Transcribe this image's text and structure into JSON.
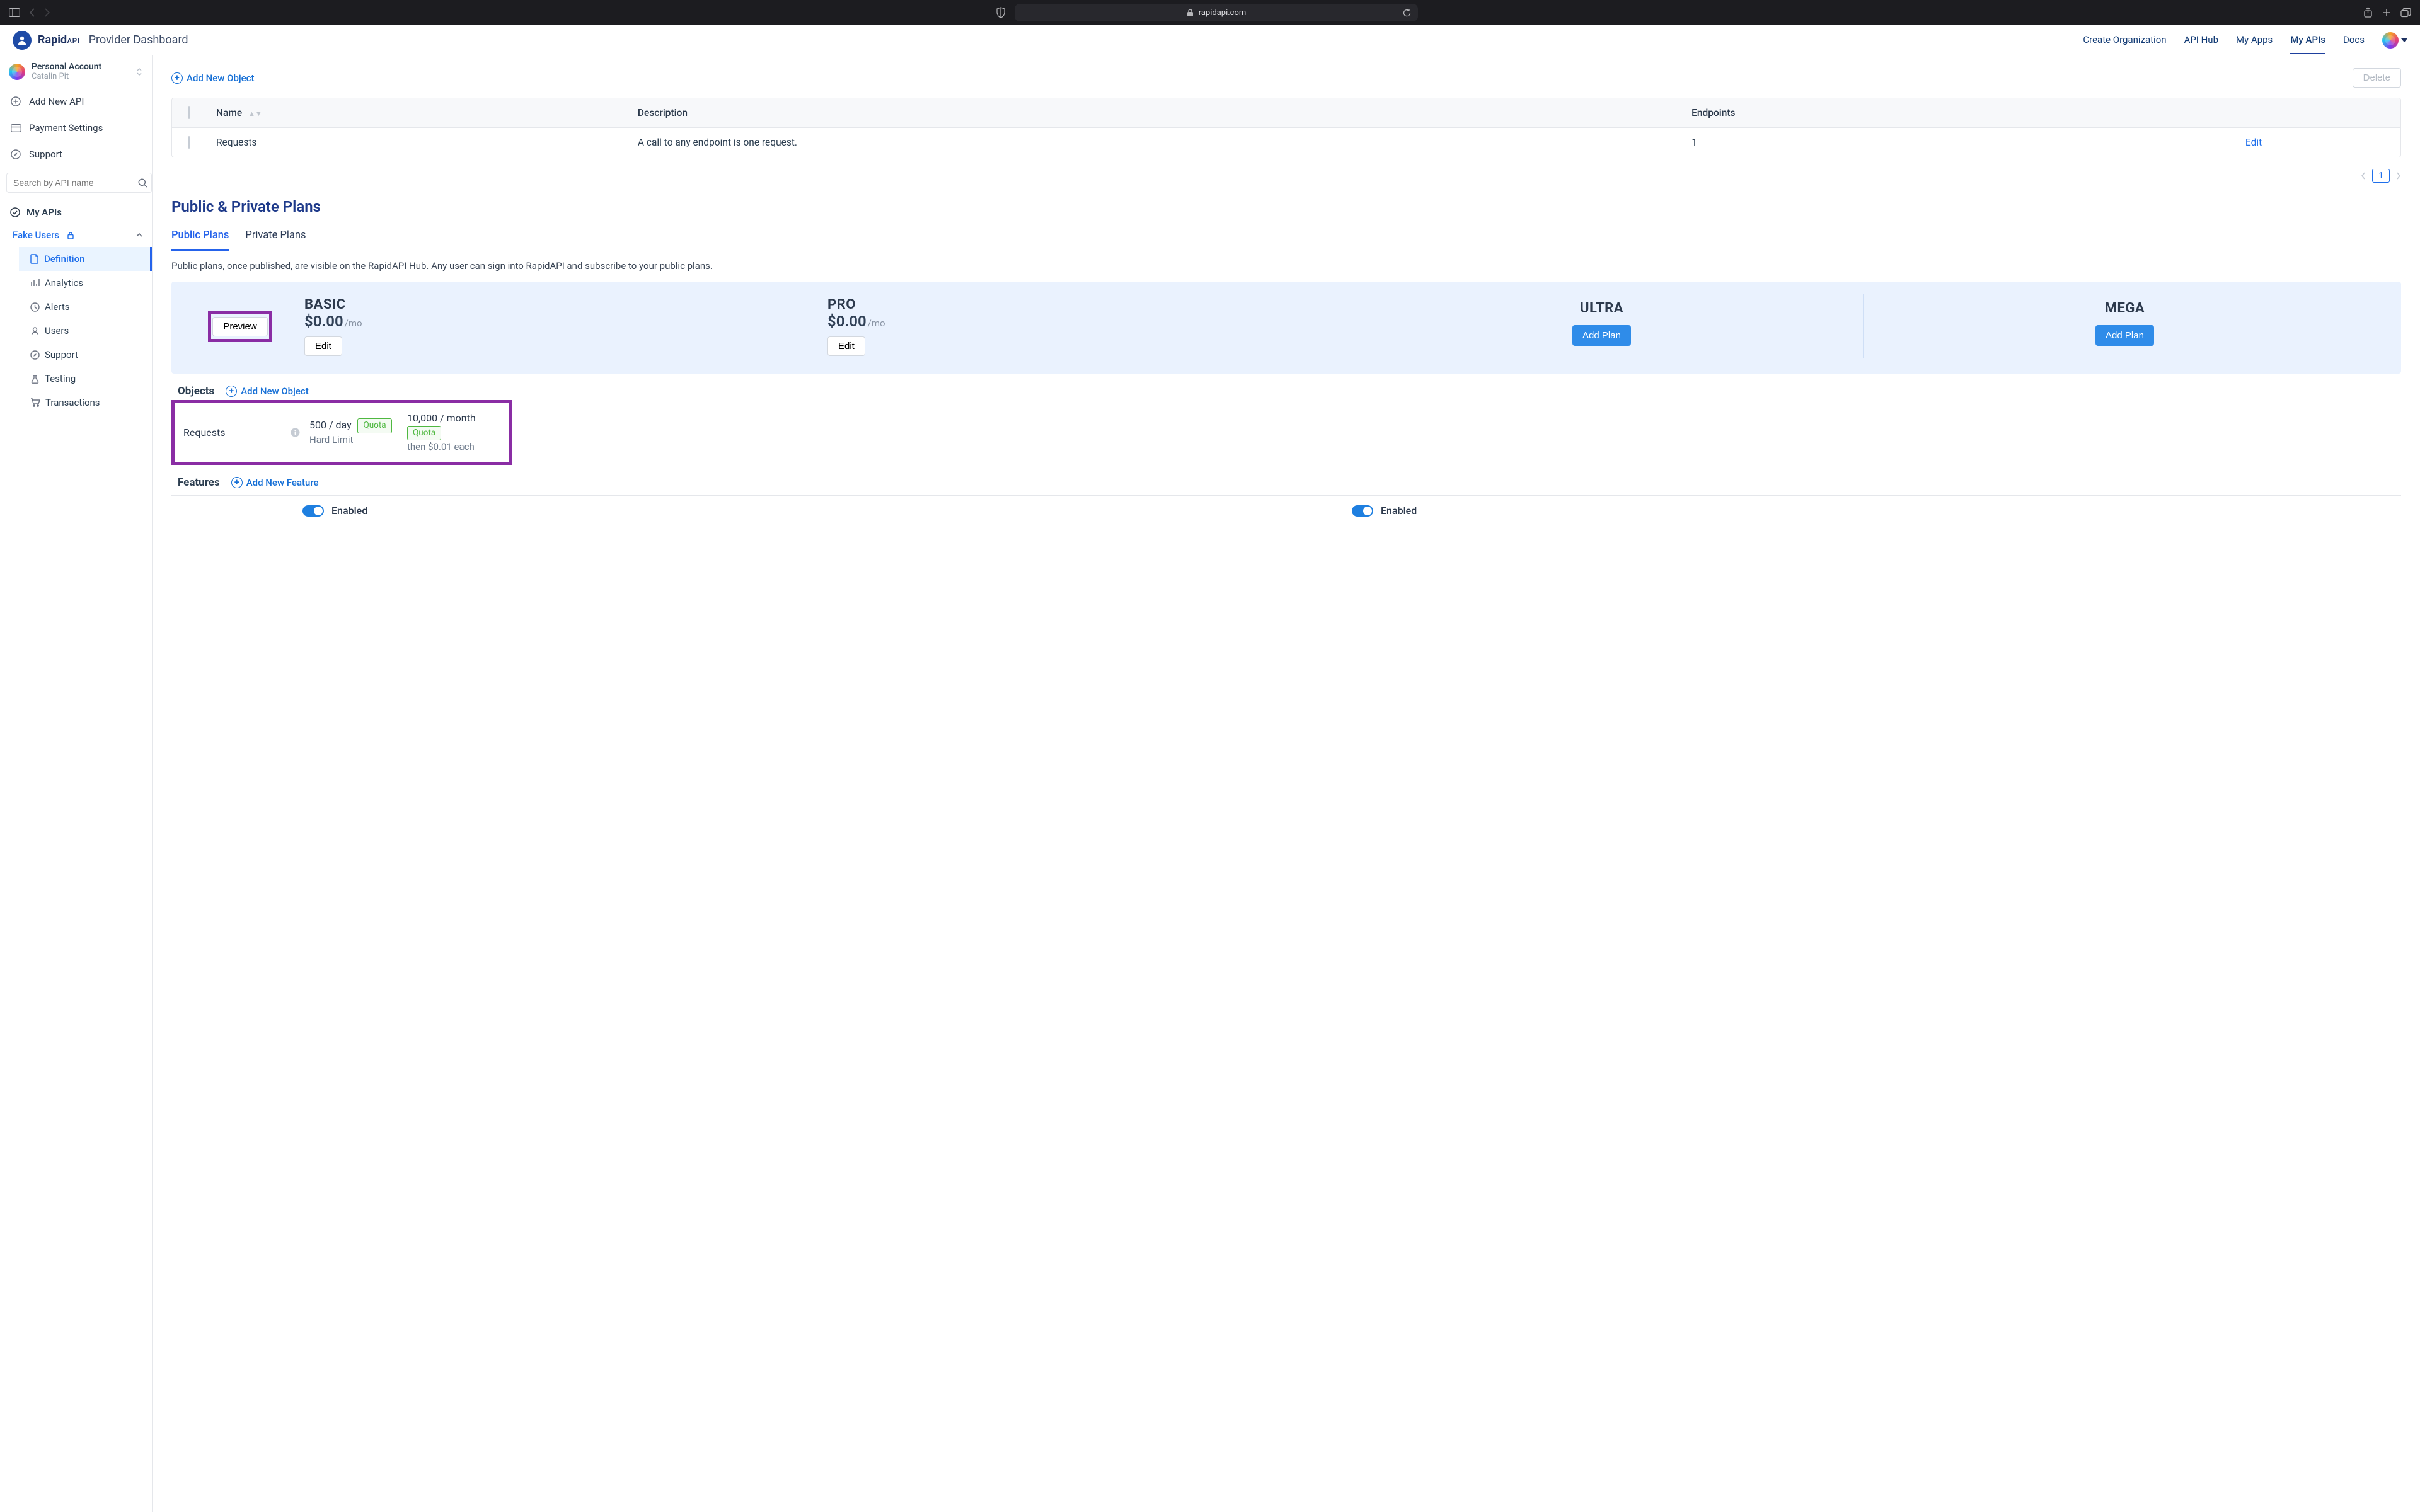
{
  "browser": {
    "url_display": "rapidapi.com"
  },
  "header": {
    "logo_primary": "Rapid",
    "logo_secondary": "API",
    "page_title": "Provider Dashboard",
    "nav": {
      "create_org": "Create Organization",
      "api_hub": "API Hub",
      "my_apps": "My Apps",
      "my_apis": "My APIs",
      "docs": "Docs"
    }
  },
  "sidebar": {
    "account_title": "Personal Account",
    "account_subtitle": "Catalin Pit",
    "add_new_api": "Add New API",
    "payment_settings": "Payment Settings",
    "support": "Support",
    "search_placeholder": "Search by API name",
    "my_apis_label": "My APIs",
    "api_name": "Fake Users",
    "items": {
      "definition": "Definition",
      "analytics": "Analytics",
      "alerts": "Alerts",
      "users": "Users",
      "support": "Support",
      "testing": "Testing",
      "transactions": "Transactions"
    }
  },
  "main": {
    "add_new_object": "Add New Object",
    "delete": "Delete",
    "table": {
      "headers": {
        "name": "Name",
        "description": "Description",
        "endpoints": "Endpoints"
      },
      "row": {
        "name": "Requests",
        "description": "A call to any endpoint is one request.",
        "endpoints": "1",
        "edit": "Edit"
      }
    },
    "pager_current": "1",
    "plans_title": "Public & Private Plans",
    "tab_public": "Public Plans",
    "tab_private": "Private Plans",
    "hint": "Public plans, once published, are visible on the RapidAPI Hub. Any user can sign into RapidAPI and subscribe to your public plans.",
    "preview_btn": "Preview",
    "edit_btn": "Edit",
    "add_plan_btn": "Add Plan",
    "plans": {
      "basic": {
        "name": "BASIC",
        "price": "$0.00",
        "period": "/mo"
      },
      "pro": {
        "name": "PRO",
        "price": "$0.00",
        "period": "/mo"
      },
      "ultra": {
        "name": "ULTRA"
      },
      "mega": {
        "name": "MEGA"
      }
    },
    "objects_label": "Objects",
    "add_new_object_inline": "Add New Object",
    "quota_label": "Quota",
    "obj": {
      "name": "Requests",
      "basic_val": "500 / day",
      "basic_sub": "Hard Limit",
      "pro_val": "10,000 / month",
      "pro_sub": "then $0.01 each"
    },
    "features_label": "Features",
    "add_new_feature": "Add New Feature",
    "enabled_label": "Enabled"
  }
}
